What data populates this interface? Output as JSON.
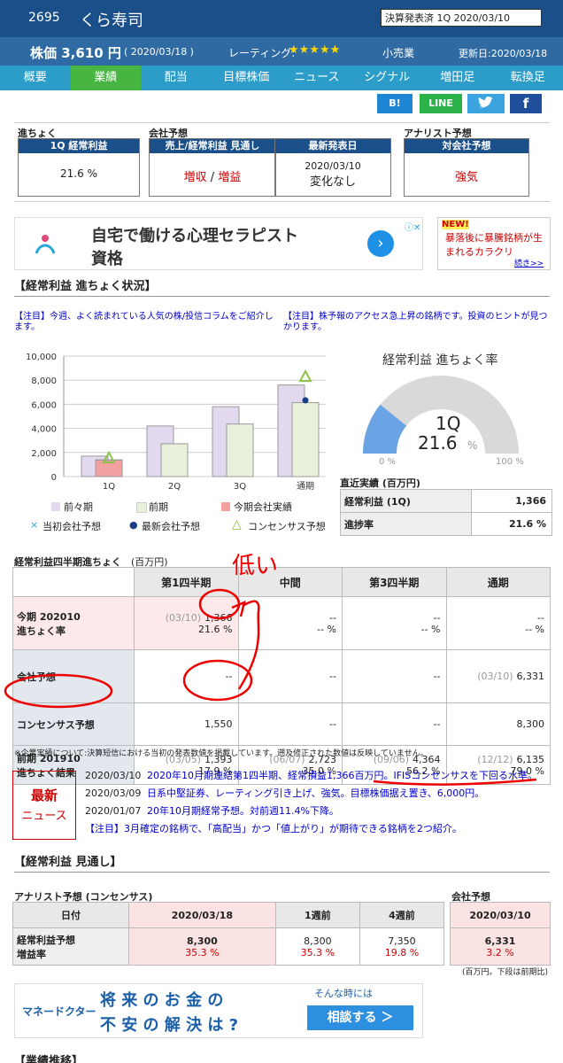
{
  "header": {
    "code": "2695",
    "name": "くら寿司",
    "badge": "決算発表済 1Q 2020/03/10",
    "price_label": "株価 3,610 円",
    "price_date": "( 2020/03/18 )",
    "rating_label": "レーティング:",
    "rating_stars": "★★★★★",
    "sector": "小売業",
    "updated": "更新日:2020/03/18"
  },
  "nav": [
    "概要",
    "業績",
    "配当",
    "目標株価",
    "ニュース",
    "シグナル",
    "増田足",
    "転換足"
  ],
  "social": {
    "hatena": "B!",
    "line": "LINE"
  },
  "summary": {
    "progress_title": "進ちょく",
    "progress_head": "1Q 経常利益",
    "progress_value": "21.6 %",
    "company_title": "会社予想",
    "outlook_head": "売上/経常利益 見通し",
    "outlook_value1": "増収",
    "outlook_sep": " / ",
    "outlook_value2": "増益",
    "latest_head": "最新発表日",
    "latest_date": "2020/03/10",
    "latest_value": "変化なし",
    "analyst_title": "アナリスト予想",
    "analyst_head": "対会社予想",
    "analyst_value": "強気"
  },
  "ad1": {
    "line1": "自宅で働ける心理セラピスト",
    "line2": "資格",
    "side_new": "NEW!",
    "side_text": "暴落後に暴騰銘柄が生まれるカラクリ",
    "side_link": "続き>>"
  },
  "section1": {
    "title": "【経常利益 進ちょく状況】",
    "note1": "【注目】今週、よく読まれている人気の株/投信コラムをご紹介します。",
    "note2": "【注目】株予報のアクセス急上昇の銘柄です。投資のヒントが見つかります。"
  },
  "chart_data": {
    "type": "bar",
    "categories": [
      "1Q",
      "2Q",
      "3Q",
      "通期"
    ],
    "yticks": [
      "10,000",
      "8,000",
      "6,000",
      "4,000",
      "2,000",
      "0"
    ],
    "ylim": [
      0,
      10000
    ],
    "series": [
      {
        "name": "前々期",
        "values": [
          1700,
          4200,
          5800,
          7600
        ],
        "color": "#e3d9ee"
      },
      {
        "name": "前期",
        "values": [
          1393,
          2723,
          4364,
          6135
        ],
        "color": "#e9f1dc"
      },
      {
        "name": "今期会社実績",
        "values": [
          1366,
          null,
          null,
          null
        ],
        "color": "#f3a0a0"
      }
    ],
    "markers": [
      {
        "name": "当初会社予想",
        "symbol": "×",
        "color": "#2aa7d8"
      },
      {
        "name": "最新会社予想",
        "symbol": "●",
        "color": "#1a3f8a",
        "values": [
          null,
          null,
          null,
          6331
        ]
      },
      {
        "name": "コンセンサス予想",
        "symbol": "△",
        "color": "#8bc34a",
        "values": [
          1550,
          null,
          null,
          8300
        ]
      }
    ]
  },
  "gauge": {
    "title": "経常利益 進ちょく率",
    "period": "1Q",
    "value": "21.6",
    "unit": "%",
    "pct": 21.6,
    "min": "0 %",
    "max": "100 %"
  },
  "recent": {
    "title": "直近実績 (百万円)",
    "row1_label": "経常利益 (1Q)",
    "row1_value": "1,366",
    "row2_label": "進捗率",
    "row2_value": "21.6 %"
  },
  "quarter": {
    "title": "経常利益四半期進ちょく",
    "unit": "(百万円)",
    "cols": [
      "第1四半期",
      "中間",
      "第3四半期",
      "通期"
    ],
    "rows": [
      {
        "label": "今期 202010\n進ちょく率",
        "cells": [
          [
            "(03/10)",
            "1,366",
            "21.6 %"
          ],
          [
            "",
            "--",
            "-- %"
          ],
          [
            "",
            "--",
            "-- %"
          ],
          [
            "",
            "--",
            "-- %"
          ]
        ]
      },
      {
        "label": "会社予想",
        "cells": [
          [
            "",
            "--",
            ""
          ],
          [
            "",
            "--",
            ""
          ],
          [
            "",
            "--",
            ""
          ],
          [
            "(03/10)",
            "6,331",
            ""
          ]
        ]
      },
      {
        "label": "コンセンサス予想",
        "cells": [
          [
            "",
            "1,550",
            ""
          ],
          [
            "",
            "--",
            ""
          ],
          [
            "",
            "--",
            ""
          ],
          [
            "",
            "8,300",
            ""
          ]
        ]
      },
      {
        "label": "前期 201910\n進ちょく結果",
        "cells": [
          [
            "(03/05)",
            "1,393",
            "17.9 %"
          ],
          [
            "(06/07)",
            "2,723",
            "35.0 %"
          ],
          [
            "(09/06)",
            "4,364",
            "56.2 %"
          ],
          [
            "(12/12)",
            "6,135",
            "79.0 %"
          ]
        ]
      }
    ],
    "footnote": "※企業実績について:決算短信における当初の発表数値を掲載しています。遡及修正された数値は反映していません。",
    "handwriting": "低い"
  },
  "news": {
    "badge1": "最新",
    "badge2": "ニュース",
    "items": [
      {
        "date": "2020/03/10",
        "text": "2020年10月期連結第1四半期、経常損益1,366百万円。IFISコンセンサスを下回る水準。"
      },
      {
        "date": "2020/03/09",
        "text": "日系中堅証券、レーティング引き上げ、強気。目標株価据え置き、6,000円。"
      },
      {
        "date": "2020/01/07",
        "text": "20年10月期経常予想。対前週11.4%下降。"
      }
    ],
    "note": "【注目】3月確定の銘柄で、「高配当」かつ「値上がり」が期待できる銘柄を2つ紹介。"
  },
  "forecast": {
    "title": "【経常利益 見通し】",
    "analyst_caption": "アナリスト予想 (コンセンサス)",
    "company_caption": "会社予想",
    "cols": [
      "日付",
      "2020/03/18",
      "1週前",
      "4週前"
    ],
    "company_col": "2020/03/10",
    "row_label": "経常利益予想\n増益率",
    "values": [
      "8,300",
      "8,300",
      "7,350"
    ],
    "rates": [
      "35.3 %",
      "35.3 %",
      "19.8 %"
    ],
    "company_value": "6,331",
    "company_rate": "3.2 %",
    "unit_note": "(百万円。下段は前期比)"
  },
  "ad2": {
    "brand": "マネードクター",
    "line1": "将 来 の お 金 の",
    "line2": "不 安 の 解 決 は ?",
    "tag": "そんな時には",
    "cta": "相談する ＞"
  },
  "section3": {
    "title": "【業績推移】"
  }
}
